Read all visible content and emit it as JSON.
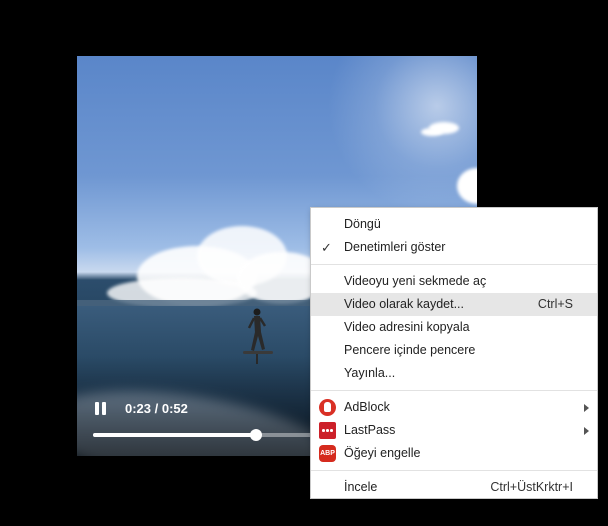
{
  "player": {
    "time_display": "0:23 / 0:52",
    "progress_fraction": 0.442,
    "state": "playing"
  },
  "context_menu": {
    "items": [
      {
        "label": "Döngü"
      },
      {
        "label": "Denetimleri göster",
        "checked": true
      },
      {
        "label": "Videoyu yeni sekmede aç"
      },
      {
        "label": "Video olarak kaydet...",
        "shortcut": "Ctrl+S",
        "highlighted": true
      },
      {
        "label": "Video adresini kopyala"
      },
      {
        "label": "Pencere içinde pencere"
      },
      {
        "label": "Yayınla..."
      },
      {
        "label": "AdBlock",
        "icon": "adblock-hand-icon",
        "submenu": true
      },
      {
        "label": "LastPass",
        "icon": "lastpass-icon",
        "submenu": true
      },
      {
        "label": "Öğeyi engelle",
        "icon": "abp-icon"
      },
      {
        "label": "İncele",
        "shortcut": "Ctrl+ÜstKrktr+I"
      }
    ],
    "check_glyph": "✓"
  },
  "colors": {
    "adblock_red": "#d93025",
    "lastpass_red": "#cc2029",
    "abp_red": "#d52b1e",
    "highlight": "#e6e6e6"
  }
}
